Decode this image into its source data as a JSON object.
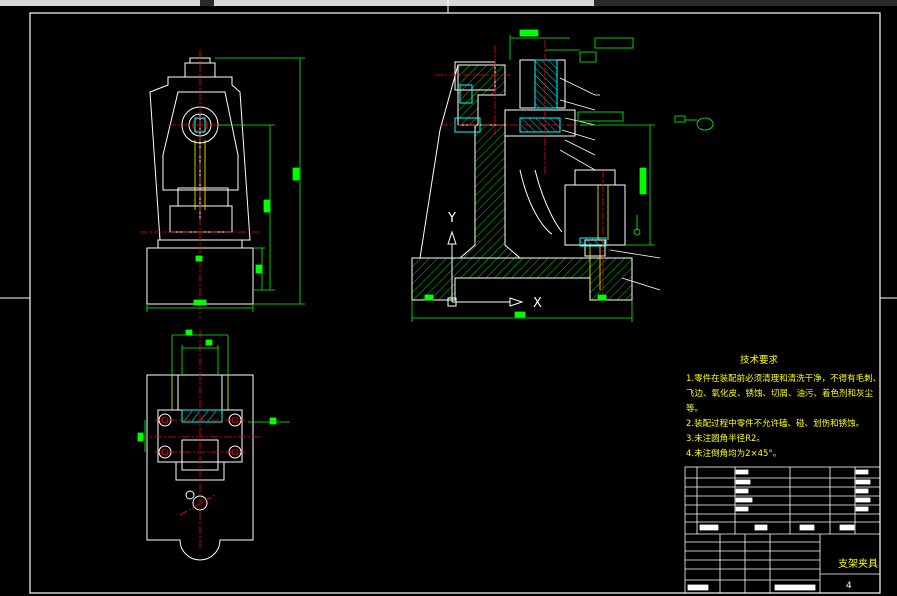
{
  "drawing": {
    "title": "支架夹具",
    "sheet_number": "4"
  },
  "technical_requirements": {
    "heading": "技术要求",
    "lines": [
      "1.零件在装配前必须清理和清洗干净，不得有毛刺、",
      "飞边、氧化皮、锈蚀、切屑、油污、着色剂和灰尘",
      "等。",
      "2.装配过程中零件不允许磕、碰、划伤和锈蚀。",
      "3.未注圆角半径R2。",
      "4.未注倒角均为2×45°。"
    ]
  },
  "axes": {
    "y_label": "Y",
    "x_label": "X"
  },
  "colors": {
    "background": "#000000",
    "outline": "#ffffff",
    "dimension": "#00ff00",
    "center_line": "#ff0000",
    "hatch": "#00ff00",
    "highlight": "#00ffff",
    "yellow": "#ffff00"
  }
}
